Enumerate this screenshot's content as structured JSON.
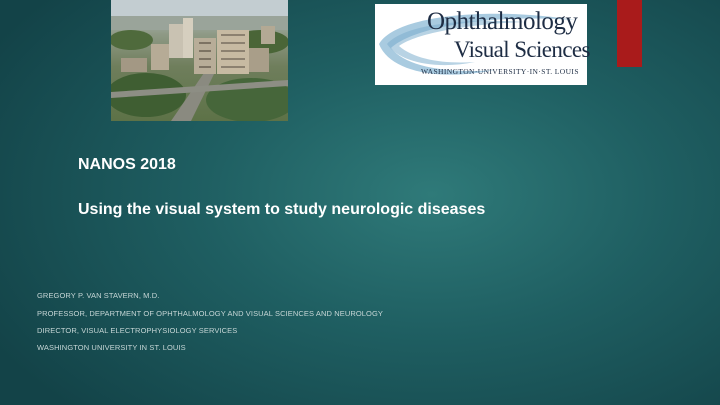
{
  "logo": {
    "line1": "Ophthalmology",
    "line2": "Visual Sciences",
    "line3": "WASHINGTON·UNIVERSITY·IN·ST. LOUIS"
  },
  "title": "NANOS 2018",
  "subtitle": "Using the visual system to study neurologic diseases",
  "presenter": {
    "name": "GREGORY P. VAN STAVERN, M.D.",
    "position": "PROFESSOR, DEPARTMENT OF OPHTHALMOLOGY AND VISUAL SCIENCES AND NEUROLOGY",
    "role": "DIRECTOR, VISUAL ELECTROPHYSIOLOGY SERVICES",
    "institution": "WASHINGTON UNIVERSITY IN ST. LOUIS"
  },
  "colors": {
    "background": "#1f5f62",
    "accent_bar": "#a91b1b",
    "logo_text": "#1e2d44",
    "logo_swoosh": "#9fc4dc"
  }
}
